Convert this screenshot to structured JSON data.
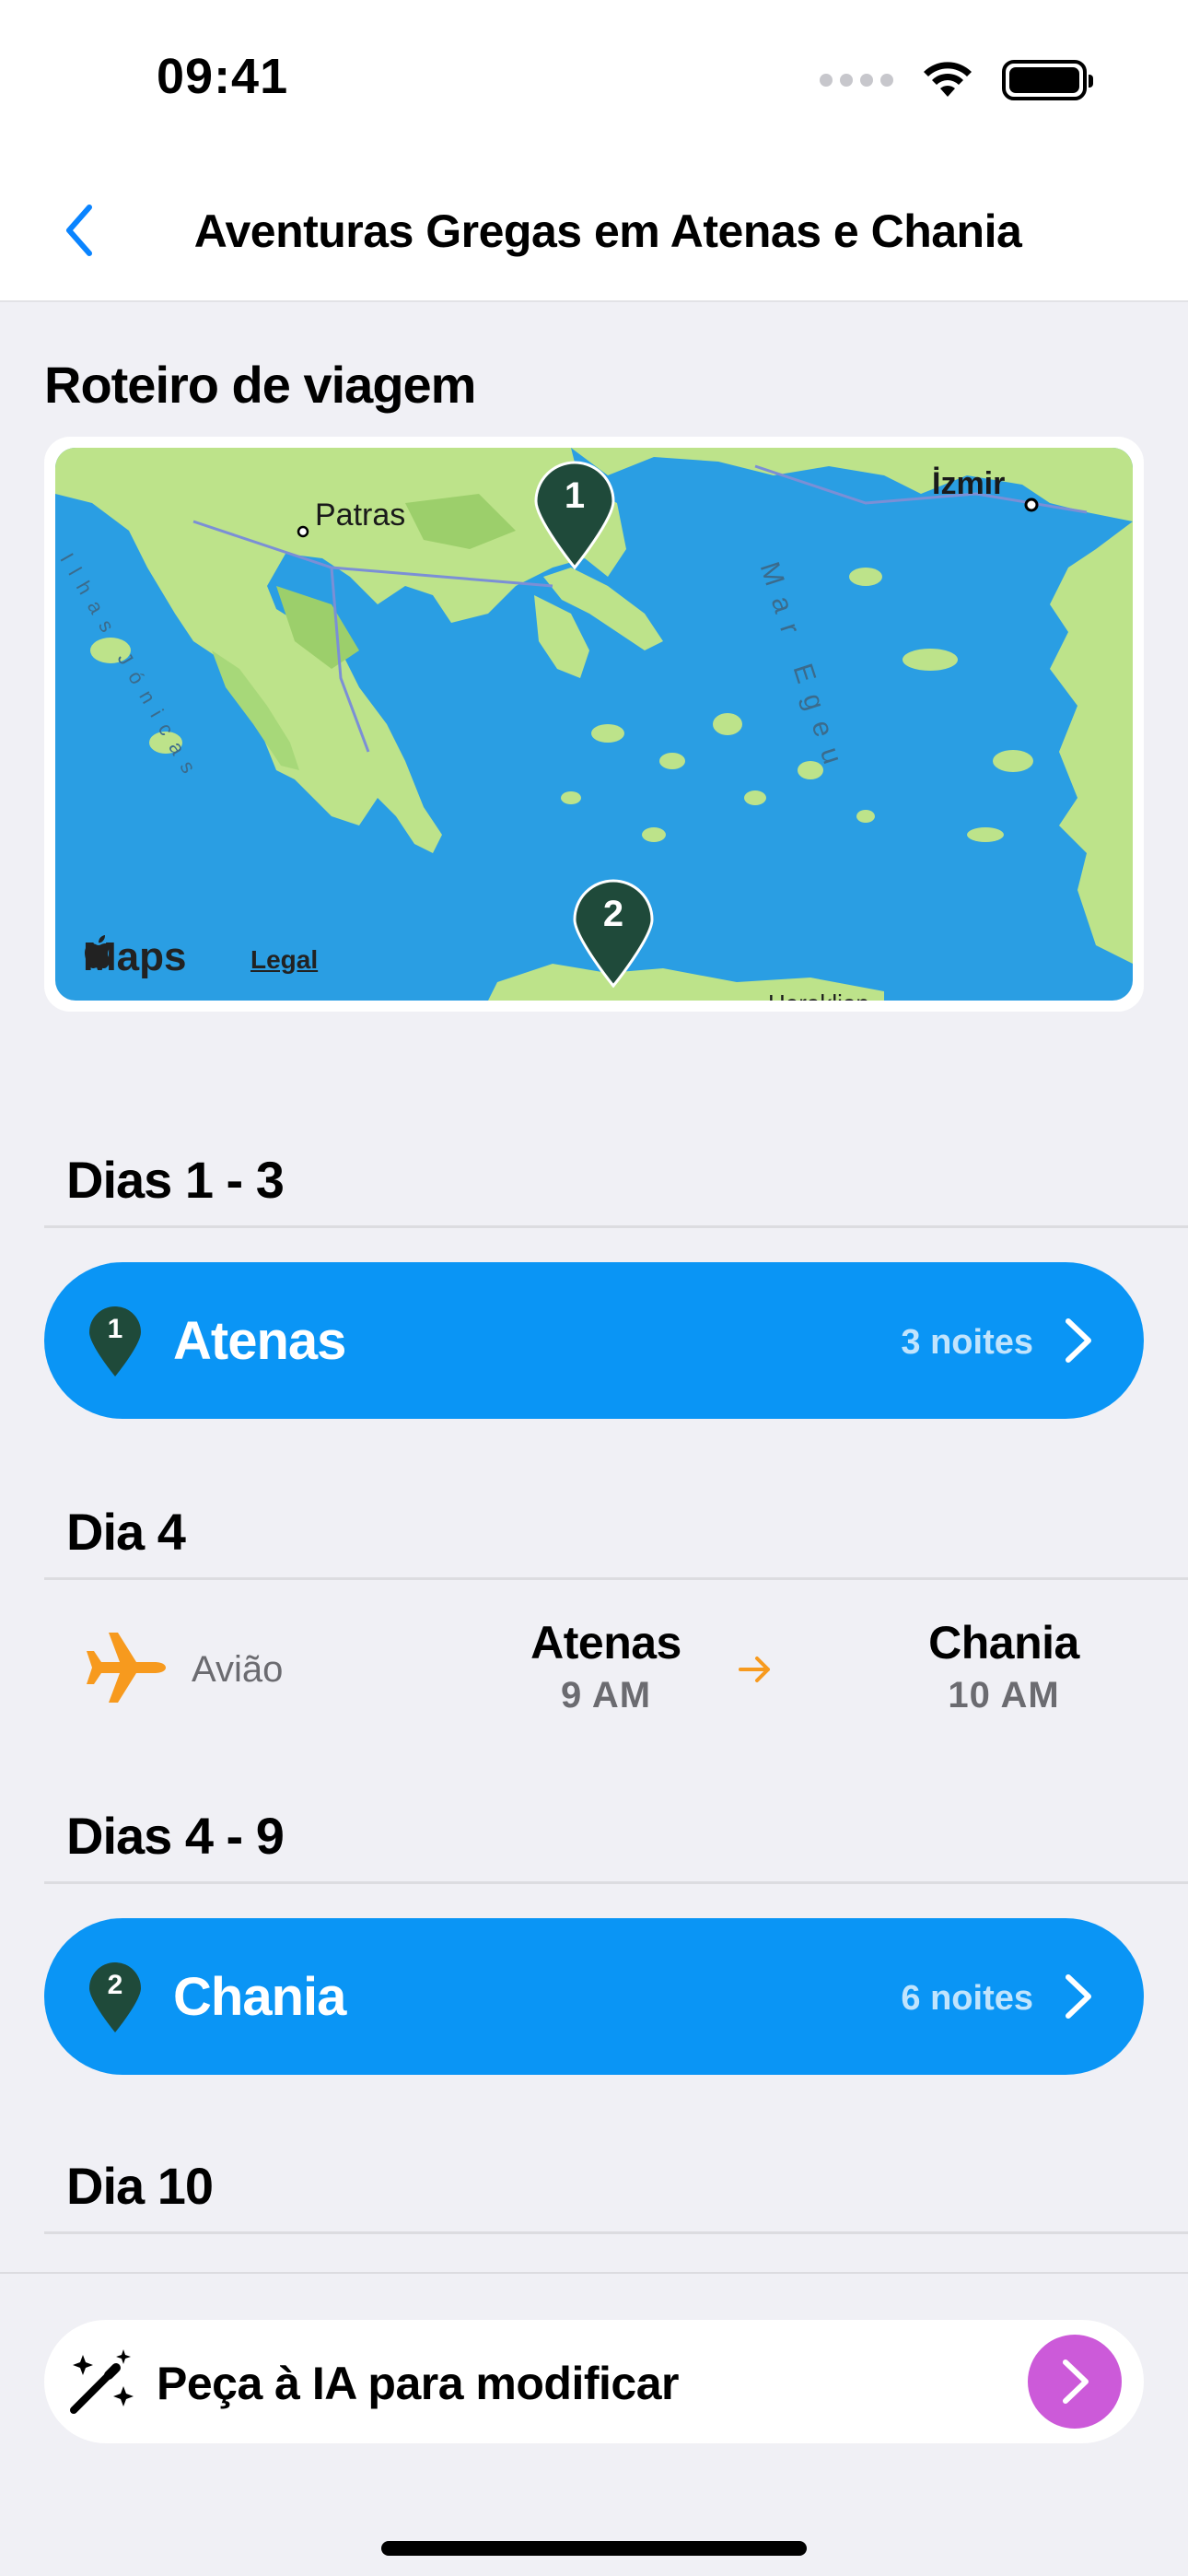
{
  "status": {
    "time": "09:41"
  },
  "nav": {
    "title": "Aventuras Gregas em Atenas e Chania",
    "back_icon": "chevron-left-icon"
  },
  "itinerary": {
    "section_title": "Roteiro de viagem",
    "map": {
      "labels": [
        "Patras",
        "İzmir",
        "Mar Egeu",
        "Ilhas Jónicas",
        "Heraklion"
      ],
      "pins": [
        "1",
        "2"
      ],
      "attribution": {
        "logo": "Maps",
        "legal": "Legal"
      }
    }
  },
  "days": [
    {
      "header": "Dias 1 - 3",
      "type": "stay",
      "pin": "1",
      "city": "Atenas",
      "nights": "3 noites"
    },
    {
      "header": "Dia 4",
      "type": "transport",
      "mode": "Avião",
      "from": {
        "place": "Atenas",
        "time": "9 AM"
      },
      "to": {
        "place": "Chania",
        "time": "10 AM"
      }
    },
    {
      "header": "Dias 4 - 9",
      "type": "stay",
      "pin": "2",
      "city": "Chania",
      "nights": "6 noites"
    },
    {
      "header": "Dia 10"
    }
  ],
  "ai_prompt": {
    "label": "Peça à IA para modificar"
  },
  "colors": {
    "accent_blue": "#0a95f5",
    "pin_green": "#1f4a3a",
    "plane_orange": "#f79a1e",
    "send_purple": "#cc5ad9"
  }
}
